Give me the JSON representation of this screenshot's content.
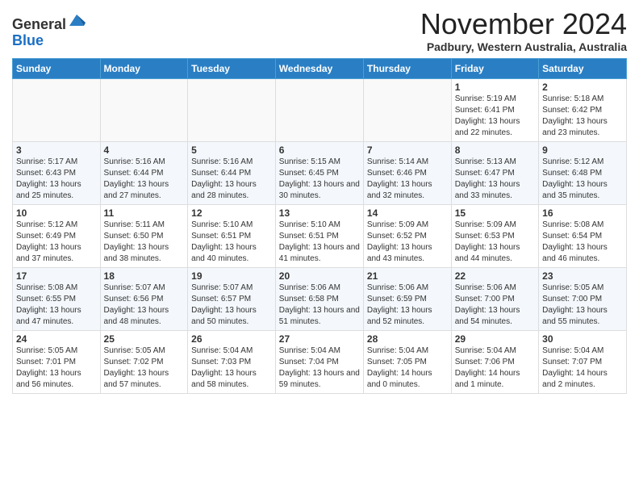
{
  "header": {
    "logo_line1": "General",
    "logo_line2": "Blue",
    "month_title": "November 2024",
    "subtitle": "Padbury, Western Australia, Australia"
  },
  "weekdays": [
    "Sunday",
    "Monday",
    "Tuesday",
    "Wednesday",
    "Thursday",
    "Friday",
    "Saturday"
  ],
  "weeks": [
    [
      {
        "day": "",
        "info": ""
      },
      {
        "day": "",
        "info": ""
      },
      {
        "day": "",
        "info": ""
      },
      {
        "day": "",
        "info": ""
      },
      {
        "day": "",
        "info": ""
      },
      {
        "day": "1",
        "info": "Sunrise: 5:19 AM\nSunset: 6:41 PM\nDaylight: 13 hours\nand 22 minutes."
      },
      {
        "day": "2",
        "info": "Sunrise: 5:18 AM\nSunset: 6:42 PM\nDaylight: 13 hours\nand 23 minutes."
      }
    ],
    [
      {
        "day": "3",
        "info": "Sunrise: 5:17 AM\nSunset: 6:43 PM\nDaylight: 13 hours\nand 25 minutes."
      },
      {
        "day": "4",
        "info": "Sunrise: 5:16 AM\nSunset: 6:44 PM\nDaylight: 13 hours\nand 27 minutes."
      },
      {
        "day": "5",
        "info": "Sunrise: 5:16 AM\nSunset: 6:44 PM\nDaylight: 13 hours\nand 28 minutes."
      },
      {
        "day": "6",
        "info": "Sunrise: 5:15 AM\nSunset: 6:45 PM\nDaylight: 13 hours\nand 30 minutes."
      },
      {
        "day": "7",
        "info": "Sunrise: 5:14 AM\nSunset: 6:46 PM\nDaylight: 13 hours\nand 32 minutes."
      },
      {
        "day": "8",
        "info": "Sunrise: 5:13 AM\nSunset: 6:47 PM\nDaylight: 13 hours\nand 33 minutes."
      },
      {
        "day": "9",
        "info": "Sunrise: 5:12 AM\nSunset: 6:48 PM\nDaylight: 13 hours\nand 35 minutes."
      }
    ],
    [
      {
        "day": "10",
        "info": "Sunrise: 5:12 AM\nSunset: 6:49 PM\nDaylight: 13 hours\nand 37 minutes."
      },
      {
        "day": "11",
        "info": "Sunrise: 5:11 AM\nSunset: 6:50 PM\nDaylight: 13 hours\nand 38 minutes."
      },
      {
        "day": "12",
        "info": "Sunrise: 5:10 AM\nSunset: 6:51 PM\nDaylight: 13 hours\nand 40 minutes."
      },
      {
        "day": "13",
        "info": "Sunrise: 5:10 AM\nSunset: 6:51 PM\nDaylight: 13 hours\nand 41 minutes."
      },
      {
        "day": "14",
        "info": "Sunrise: 5:09 AM\nSunset: 6:52 PM\nDaylight: 13 hours\nand 43 minutes."
      },
      {
        "day": "15",
        "info": "Sunrise: 5:09 AM\nSunset: 6:53 PM\nDaylight: 13 hours\nand 44 minutes."
      },
      {
        "day": "16",
        "info": "Sunrise: 5:08 AM\nSunset: 6:54 PM\nDaylight: 13 hours\nand 46 minutes."
      }
    ],
    [
      {
        "day": "17",
        "info": "Sunrise: 5:08 AM\nSunset: 6:55 PM\nDaylight: 13 hours\nand 47 minutes."
      },
      {
        "day": "18",
        "info": "Sunrise: 5:07 AM\nSunset: 6:56 PM\nDaylight: 13 hours\nand 48 minutes."
      },
      {
        "day": "19",
        "info": "Sunrise: 5:07 AM\nSunset: 6:57 PM\nDaylight: 13 hours\nand 50 minutes."
      },
      {
        "day": "20",
        "info": "Sunrise: 5:06 AM\nSunset: 6:58 PM\nDaylight: 13 hours\nand 51 minutes."
      },
      {
        "day": "21",
        "info": "Sunrise: 5:06 AM\nSunset: 6:59 PM\nDaylight: 13 hours\nand 52 minutes."
      },
      {
        "day": "22",
        "info": "Sunrise: 5:06 AM\nSunset: 7:00 PM\nDaylight: 13 hours\nand 54 minutes."
      },
      {
        "day": "23",
        "info": "Sunrise: 5:05 AM\nSunset: 7:00 PM\nDaylight: 13 hours\nand 55 minutes."
      }
    ],
    [
      {
        "day": "24",
        "info": "Sunrise: 5:05 AM\nSunset: 7:01 PM\nDaylight: 13 hours\nand 56 minutes."
      },
      {
        "day": "25",
        "info": "Sunrise: 5:05 AM\nSunset: 7:02 PM\nDaylight: 13 hours\nand 57 minutes."
      },
      {
        "day": "26",
        "info": "Sunrise: 5:04 AM\nSunset: 7:03 PM\nDaylight: 13 hours\nand 58 minutes."
      },
      {
        "day": "27",
        "info": "Sunrise: 5:04 AM\nSunset: 7:04 PM\nDaylight: 13 hours\nand 59 minutes."
      },
      {
        "day": "28",
        "info": "Sunrise: 5:04 AM\nSunset: 7:05 PM\nDaylight: 14 hours\nand 0 minutes."
      },
      {
        "day": "29",
        "info": "Sunrise: 5:04 AM\nSunset: 7:06 PM\nDaylight: 14 hours\nand 1 minute."
      },
      {
        "day": "30",
        "info": "Sunrise: 5:04 AM\nSunset: 7:07 PM\nDaylight: 14 hours\nand 2 minutes."
      }
    ]
  ]
}
